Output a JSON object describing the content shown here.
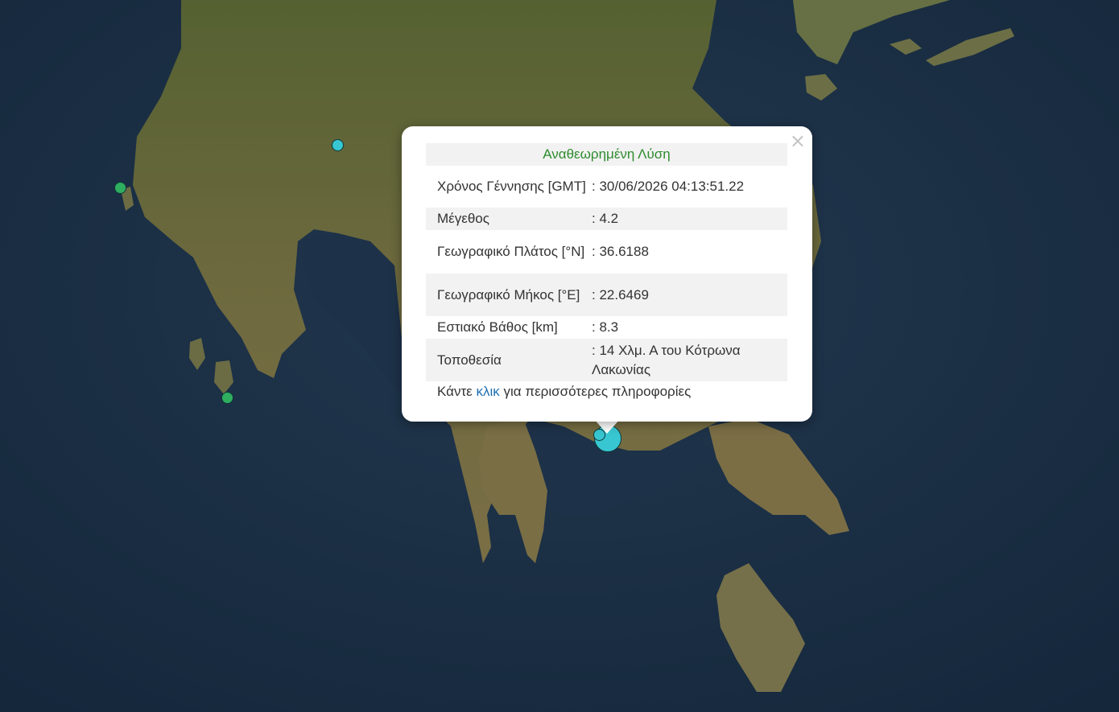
{
  "popup": {
    "title": "Αναθεωρημένη Λύση",
    "close_glyph": "×",
    "rows": [
      {
        "label": "Χρόνος Γέννησης [GMT]",
        "value": ": 30/06/2026 04:13:51.22"
      },
      {
        "label": "Μέγεθος",
        "value": ": 4.2"
      },
      {
        "label": "Γεωγραφικό Πλάτος [°N]",
        "value": ": 36.6188"
      },
      {
        "label": "Γεωγραφικό Μήκος [°E]",
        "value": ": 22.6469"
      },
      {
        "label": "Εστιακό Βάθος [km]",
        "value": ": 8.3"
      },
      {
        "label": "Τοποθεσία",
        "value": ": 14 Χλμ. Α του Κότρωνα Λακωνίας"
      }
    ],
    "more_prefix": "Κάντε",
    "more_link": "κλικ",
    "more_suffix": "για περισσότερες πληροφορίες"
  },
  "markers": [
    {
      "name": "earthquake-marker-inland",
      "color": "cyan"
    },
    {
      "name": "earthquake-marker-west-coast",
      "color": "green"
    },
    {
      "name": "earthquake-marker-south-islet",
      "color": "green"
    },
    {
      "name": "earthquake-marker-selected-large",
      "color": "cyan"
    },
    {
      "name": "earthquake-marker-selected-small",
      "color": "cyan"
    }
  ],
  "colors": {
    "sea": "#1b2e44",
    "land": "#6d6a3e",
    "marker_cyan": "#38c7d2",
    "marker_green": "#2fae5f",
    "title_green": "#2e8b2e",
    "link_blue": "#1f6fb0"
  }
}
